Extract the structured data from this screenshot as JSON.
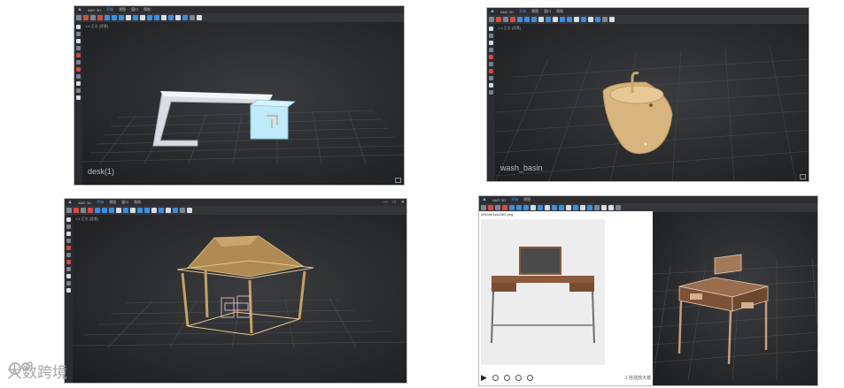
{
  "app": {
    "title": "AMC 3D"
  },
  "menu": [
    "开始",
    "视图",
    "窗口",
    "帮助"
  ],
  "viewport_header": "1:4 正交 [背景]",
  "panels": {
    "desk": {
      "object_label": "desk(1)"
    },
    "basin": {
      "object_label": "wash_basin"
    },
    "pavilion": {
      "object_label": ""
    },
    "dresser": {
      "browser_address": "WS/dre1ss43#0.png",
      "play_icon": "play",
      "zoom_text": "1 检测放大镜"
    }
  },
  "window_controls": [
    "—",
    "□",
    "✕"
  ],
  "watermark": {
    "text": "大数跨境"
  },
  "colors": {
    "panel_bg": "#1f2022",
    "toolbar_blue": "#3b8fe0",
    "toolbar_red": "#d94b3e",
    "mesh_cyan": "#bfeaf7",
    "basin_tan": "#d8b57e",
    "pavilion_gold": "#c8a062",
    "dresser_wood": "#8a5a3c"
  }
}
